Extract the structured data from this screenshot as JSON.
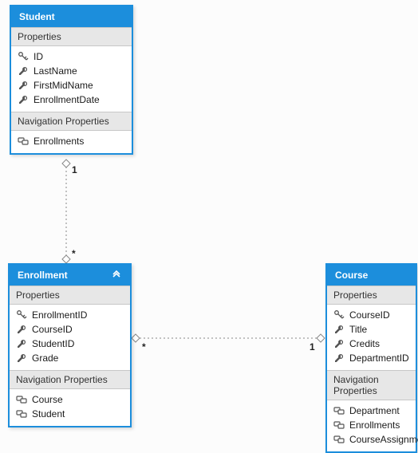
{
  "entities": {
    "student": {
      "title": "Student",
      "sections": {
        "props": {
          "header": "Properties",
          "items": [
            {
              "icon": "key",
              "label": "ID"
            },
            {
              "icon": "wrench",
              "label": "LastName"
            },
            {
              "icon": "wrench",
              "label": "FirstMidName"
            },
            {
              "icon": "wrench",
              "label": "EnrollmentDate"
            }
          ]
        },
        "nav": {
          "header": "Navigation Properties",
          "items": [
            {
              "icon": "nav",
              "label": "Enrollments"
            }
          ]
        }
      }
    },
    "enrollment": {
      "title": "Enrollment",
      "chevron": true,
      "sections": {
        "props": {
          "header": "Properties",
          "items": [
            {
              "icon": "key",
              "label": "EnrollmentID"
            },
            {
              "icon": "wrench",
              "label": "CourseID"
            },
            {
              "icon": "wrench",
              "label": "StudentID"
            },
            {
              "icon": "wrench",
              "label": "Grade"
            }
          ]
        },
        "nav": {
          "header": "Navigation Properties",
          "items": [
            {
              "icon": "nav",
              "label": "Course"
            },
            {
              "icon": "nav",
              "label": "Student"
            }
          ]
        }
      }
    },
    "course": {
      "title": "Course",
      "sections": {
        "props": {
          "header": "Properties",
          "items": [
            {
              "icon": "key",
              "label": "CourseID"
            },
            {
              "icon": "wrench",
              "label": "Title"
            },
            {
              "icon": "wrench",
              "label": "Credits"
            },
            {
              "icon": "wrench",
              "label": "DepartmentID"
            }
          ]
        },
        "nav": {
          "header": "Navigation Properties",
          "items": [
            {
              "icon": "nav",
              "label": "Department"
            },
            {
              "icon": "nav",
              "label": "Enrollments"
            },
            {
              "icon": "nav",
              "label": "CourseAssignments"
            }
          ]
        }
      }
    }
  },
  "multiplicities": {
    "student_one": "1",
    "enrollment_star_up": "*",
    "enrollment_star_right": "*",
    "course_one": "1"
  },
  "chart_data": {
    "type": "table",
    "description": "Entity relationship diagram",
    "entities": [
      "Student",
      "Enrollment",
      "Course"
    ],
    "relationships": [
      {
        "from": "Student",
        "to": "Enrollment",
        "from_mult": "1",
        "to_mult": "*"
      },
      {
        "from": "Course",
        "to": "Enrollment",
        "from_mult": "1",
        "to_mult": "*"
      }
    ]
  }
}
